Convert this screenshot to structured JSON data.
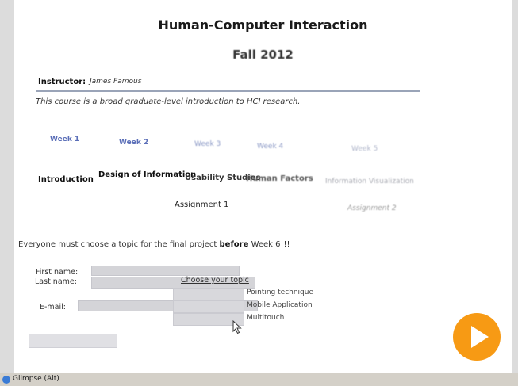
{
  "page": {
    "title": "Human-Computer Interaction",
    "subtitle": "Fall 2012",
    "instructor_label": "Instructor:",
    "instructor_name": "James Famous",
    "description": "This course is a broad graduate-level introduction to HCI research."
  },
  "weeks": [
    "Week 1",
    "Week 2",
    "Week 3",
    "Week 4",
    "Week 5"
  ],
  "topics": [
    "Introduction",
    "Design of Information",
    "Usability Studies",
    "Human Factors",
    "Information Visualization"
  ],
  "assignments": [
    "Assignment 1",
    "Assignment 2"
  ],
  "notice": {
    "prefix": "Everyone must choose a topic for the final project",
    "emphasis": "before",
    "suffix": "Week 6!!!"
  },
  "form": {
    "first_name_label": "First name:",
    "last_name_label": "Last name:",
    "email_label": "E-mail:",
    "choose_topic_label": "Choose your topic",
    "topic_options": [
      "Pointing technique",
      "Mobile Application",
      "Multitouch"
    ]
  },
  "statusbar": {
    "text": "Glimpse (Alt)"
  },
  "colors": {
    "accent_play": "#f79a14",
    "week_link": "#5b6fb8"
  }
}
